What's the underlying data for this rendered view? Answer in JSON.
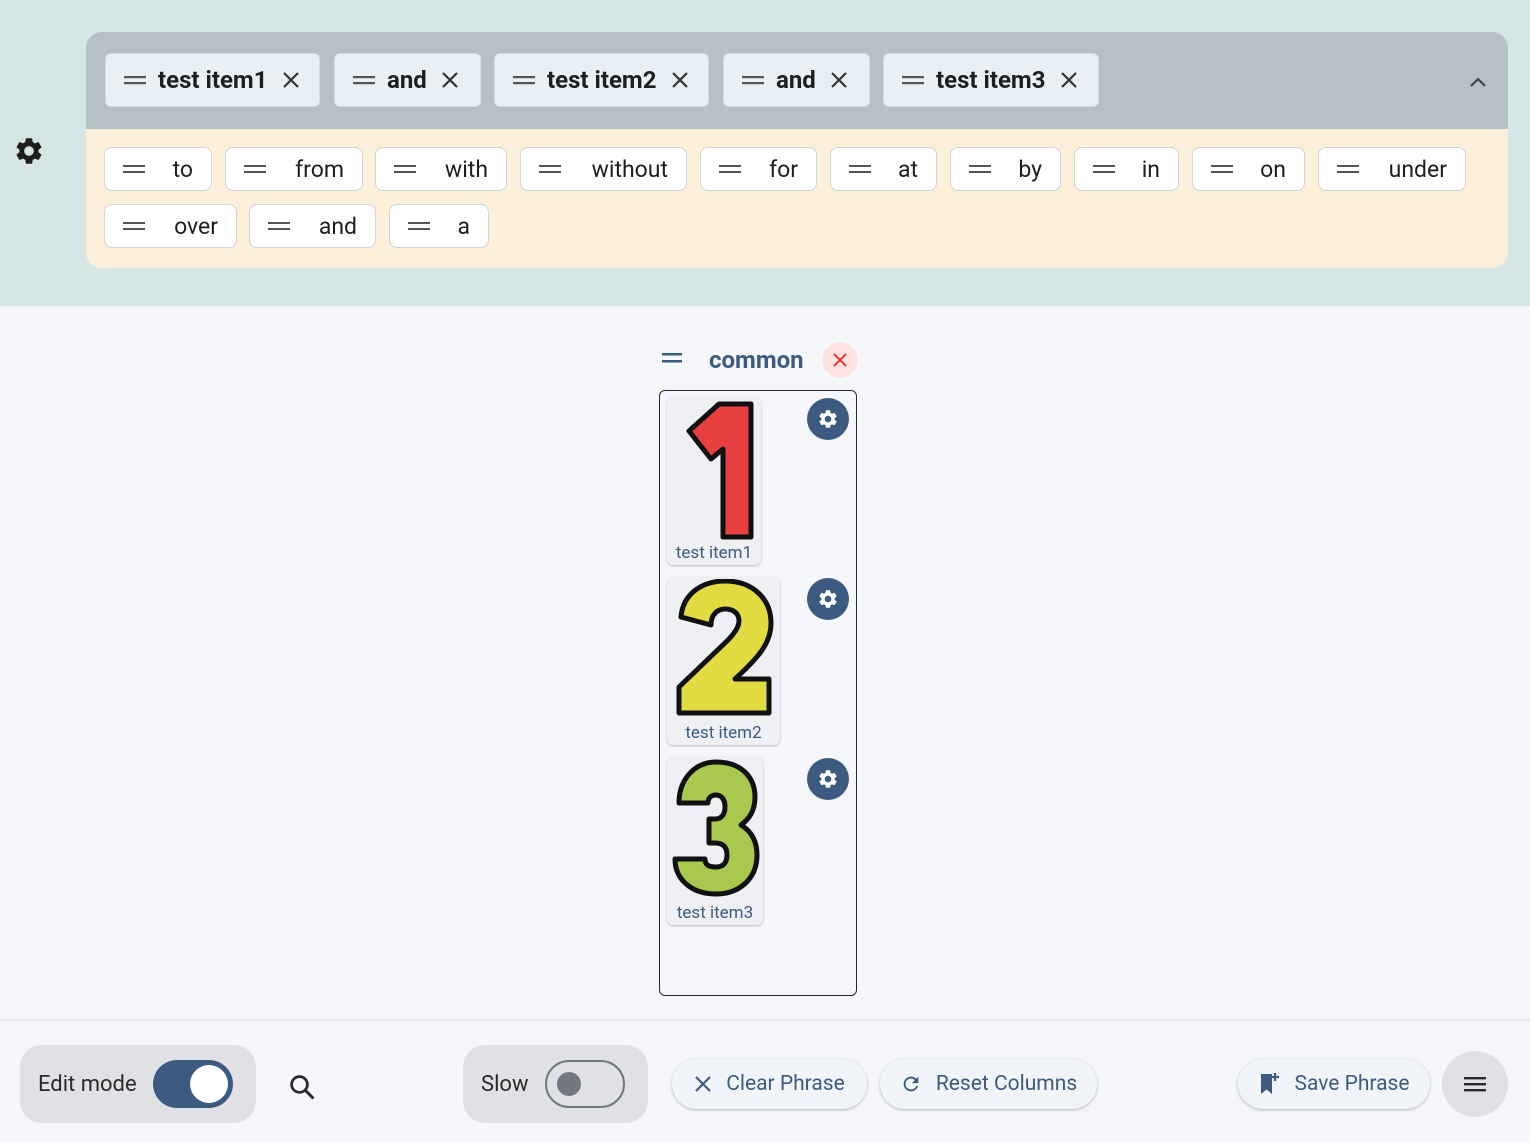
{
  "phrase": {
    "items": [
      {
        "label": "test item1"
      },
      {
        "label": "and"
      },
      {
        "label": "test item2"
      },
      {
        "label": "and"
      },
      {
        "label": "test item3"
      }
    ]
  },
  "words": [
    {
      "label": "to"
    },
    {
      "label": "from"
    },
    {
      "label": "with"
    },
    {
      "label": "without"
    },
    {
      "label": "for"
    },
    {
      "label": "at"
    },
    {
      "label": "by"
    },
    {
      "label": "in"
    },
    {
      "label": "on"
    },
    {
      "label": "under"
    },
    {
      "label": "over"
    },
    {
      "label": "and"
    },
    {
      "label": "a"
    }
  ],
  "column": {
    "title": "common",
    "tiles": [
      {
        "label": "test item1",
        "symbol": "1",
        "color": "#e84040"
      },
      {
        "label": "test item2",
        "symbol": "2",
        "color": "#e2dc42"
      },
      {
        "label": "test item3",
        "symbol": "3",
        "color": "#a8c84e"
      }
    ]
  },
  "bottom": {
    "edit_mode_label": "Edit mode",
    "edit_mode_on": true,
    "slow_label": "Slow",
    "slow_on": false,
    "clear_label": "Clear Phrase",
    "reset_label": "Reset Columns",
    "save_label": "Save Phrase"
  },
  "colors": {
    "accent": "#3d5a80",
    "top_background": "#d6e6e4",
    "phrase_bar": "#b5c1c6",
    "words_background": "#fdf0da",
    "remove_red": "#e53935"
  },
  "icons": {
    "drag_handle": "drag-handle-icon",
    "close": "close-icon",
    "gear": "gear-icon",
    "search": "search-icon",
    "chevron_up": "chevron-up-icon",
    "bookmark_add": "bookmark-add-icon",
    "refresh": "refresh-icon",
    "menu": "menu-icon"
  }
}
